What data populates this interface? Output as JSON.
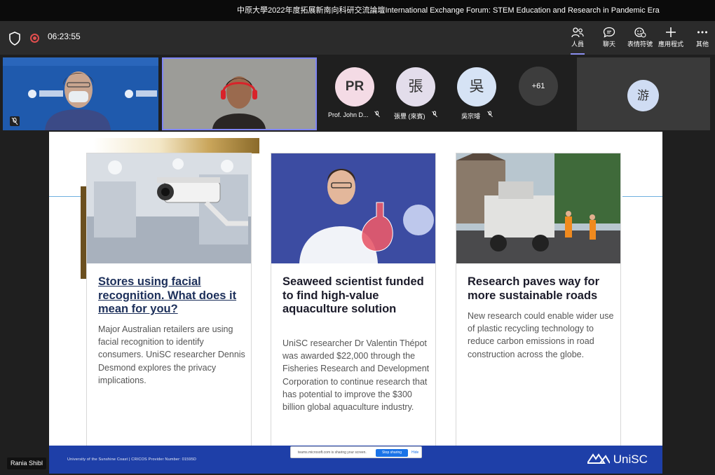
{
  "window": {
    "title": "中原大學2022年度拓展新南向科研交流論壇International Exchange Forum: STEM Education and Research in Pandemic Era"
  },
  "toolbar": {
    "timer": "06:23:55",
    "buttons": [
      {
        "label": "人員",
        "icon": "people-icon",
        "active": true
      },
      {
        "label": "聊天",
        "icon": "chat-icon",
        "active": false
      },
      {
        "label": "表情符號",
        "icon": "emoji-icon",
        "active": false
      },
      {
        "label": "應用程式",
        "icon": "plus-icon",
        "active": false
      },
      {
        "label": "其他",
        "icon": "more-icon",
        "active": false
      }
    ]
  },
  "participants": [
    {
      "initials": "PR",
      "name": "Prof. John D...",
      "color": "#f4dbe5"
    },
    {
      "initials": "張",
      "name": "張豐 (來賓)",
      "color": "#e3ddeb"
    },
    {
      "initials": "吳",
      "name": "吳宗璿",
      "color": "#d6e3f5"
    }
  ],
  "overflow_count": "+61",
  "self_tile": {
    "initials": "游",
    "color": "#cfdcf3"
  },
  "presenter_name": "Rania Shibl",
  "slide": {
    "cards": [
      {
        "title": "Stores using facial recognition. What does it mean for you?",
        "body": "Major Australian retailers are using facial recognition to identify consumers. UniSC researcher Dennis Desmond explores the privacy implications."
      },
      {
        "title": "Seaweed scientist funded to find high-value aquaculture solution",
        "body": "UniSC researcher Dr Valentin Thépot was awarded $22,000 through the Fisheries Research and Development Corporation to continue research that has potential to improve the $300 billion global aquaculture industry."
      },
      {
        "title": "Research paves way for more sustainable roads",
        "body": "New research could enable wider use of plastic recycling technology to reduce carbon emissions in road construction across the globe."
      }
    ],
    "footer_text": "University of the Sunshine Coast   |   CRICOS Provider Number: 01595D",
    "logo_text": "UniSC"
  },
  "share_bar": {
    "message": "teams.microsoft.com is sharing your screen.",
    "stop_label": "Stop sharing",
    "hide_label": "Hide"
  },
  "colors": {
    "active_accent": "#7f85f5",
    "slide_footer": "#1e3fa8",
    "rec_red": "#e04e4e"
  }
}
